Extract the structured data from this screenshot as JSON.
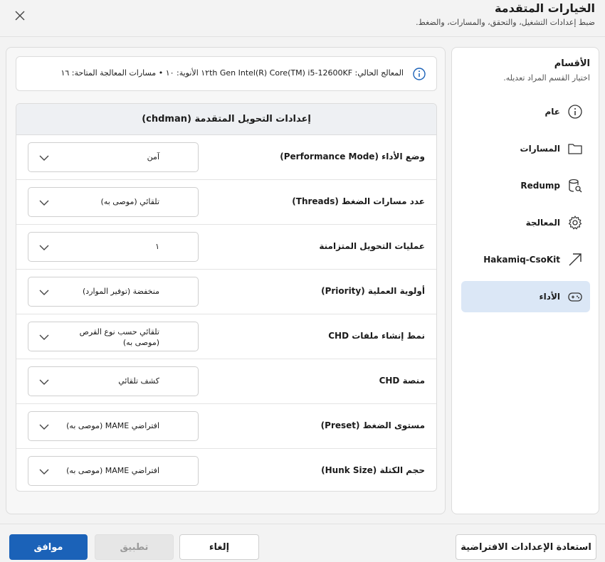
{
  "header": {
    "title": "الخيارات المتقدمة",
    "subtitle": "ضبط إعدادات التشغيل، والتحقق، والمسارات، والضغط."
  },
  "sidebar": {
    "title": "الأقسام",
    "subtitle": "اختيار القسم المراد تعديله.",
    "items": [
      {
        "label": "عام",
        "icon": "info-icon"
      },
      {
        "label": "المسارات",
        "icon": "folder-icon"
      },
      {
        "label": "Redump",
        "icon": "database-search-icon"
      },
      {
        "label": "المعالجة",
        "icon": "gear-icon"
      },
      {
        "label": "Hakamiq-CsoKit",
        "icon": "arrow-up-right-icon"
      },
      {
        "label": "الأداء",
        "icon": "gamepad-icon"
      }
    ],
    "active_index": 5
  },
  "info": {
    "text": "المعالج الحالي: 12600KF-١٢th Gen Intel(R) Core(TM) i5 الأنوية: ١٠ • مسارات المعالجة المتاحة: ١٦"
  },
  "settings": {
    "title": "إعدادات التحويل المتقدمة (chdman)",
    "rows": [
      {
        "label": "وضع الأداء (Performance Mode)",
        "value": "آمن"
      },
      {
        "label": "عدد مسارات الضغط (Threads)",
        "value": "تلقائي (موصى به)"
      },
      {
        "label": "عمليات التحويل المتزامنة",
        "value": "١"
      },
      {
        "label": "أولوية العملية (Priority)",
        "value": "منخفضة (توفير الموارد)"
      },
      {
        "label": "نمط إنشاء ملفات CHD",
        "value": "تلقائي حسب نوع القرص (موصى به)"
      },
      {
        "label": "منصة CHD",
        "value": "كشف تلقائي"
      },
      {
        "label": "مستوى الضغط (Preset)",
        "value": "افتراضي MAME (موصى به)"
      },
      {
        "label": "حجم الكتلة (Hunk Size)",
        "value": "افتراضي MAME (موصى به)"
      }
    ]
  },
  "footer": {
    "ok": "موافق",
    "apply": "تطبيق",
    "cancel": "إلغاء",
    "restore": "استعادة الإعدادات الافتراضية"
  },
  "colors": {
    "accent": "#1b62b8",
    "active_item_bg": "#dbe7f6"
  }
}
